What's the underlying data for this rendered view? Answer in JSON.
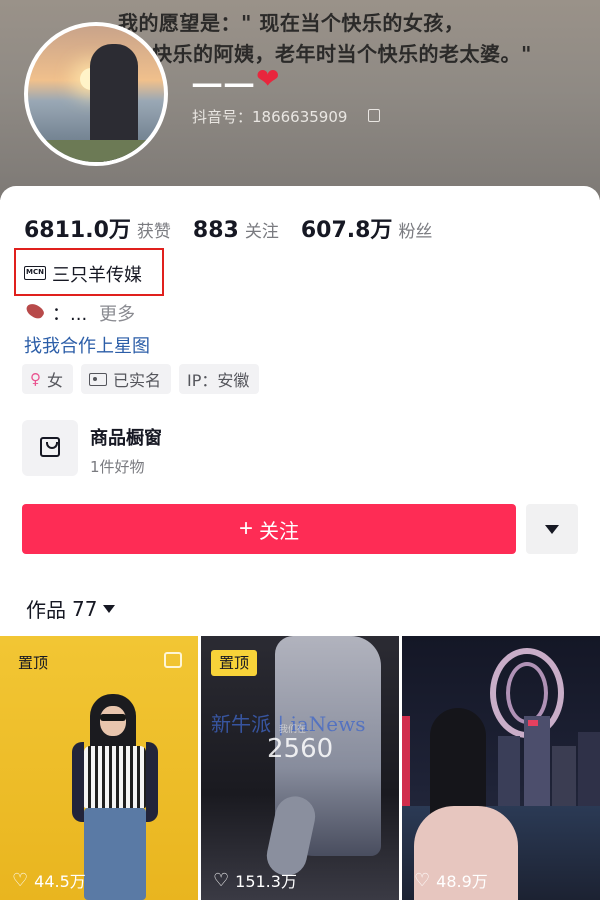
{
  "header": {
    "banner_line1": "我的愿望是：\" 现在当个快乐的女孩，",
    "banner_line2": "快乐的阿姨，老年时当个快乐的老太婆。\"",
    "nickname": "一一",
    "heart": "❤",
    "douyin_id": "抖音号：1866635909"
  },
  "stats": [
    {
      "num": "6811.0万",
      "label": "获赞"
    },
    {
      "num": "883",
      "label": "关注"
    },
    {
      "num": "607.8万",
      "label": "粉丝"
    }
  ],
  "mcn": {
    "icon_text": "MCN",
    "name": "三只羊传媒"
  },
  "bio": {
    "text": "：...",
    "more": "更多"
  },
  "star_link": "找我合作上星图",
  "tags": [
    {
      "icon": "♀",
      "label": "女"
    },
    {
      "icon": "id-card-icon",
      "label": "已实名"
    },
    {
      "icon": "",
      "label": "IP：安徽"
    }
  ],
  "shop": {
    "title": "商品橱窗",
    "subtitle": "1件好物"
  },
  "follow_button": {
    "plus": "+",
    "label": "关注"
  },
  "works": {
    "label": "作品",
    "count": "77"
  },
  "videos": [
    {
      "pin": "置顶",
      "likes": "44.5万"
    },
    {
      "pin": "置顶",
      "likes": "151.3万",
      "overlay_number": "2560",
      "watermark": "新牛派 | iaNews",
      "small_text": "我们在"
    },
    {
      "pin": "",
      "likes": "48.9万"
    }
  ],
  "colors": {
    "accent": "#fe2c55",
    "link": "#2c5ea8",
    "highlight_box": "#e0201d",
    "pin_badge": "#f8d339"
  }
}
